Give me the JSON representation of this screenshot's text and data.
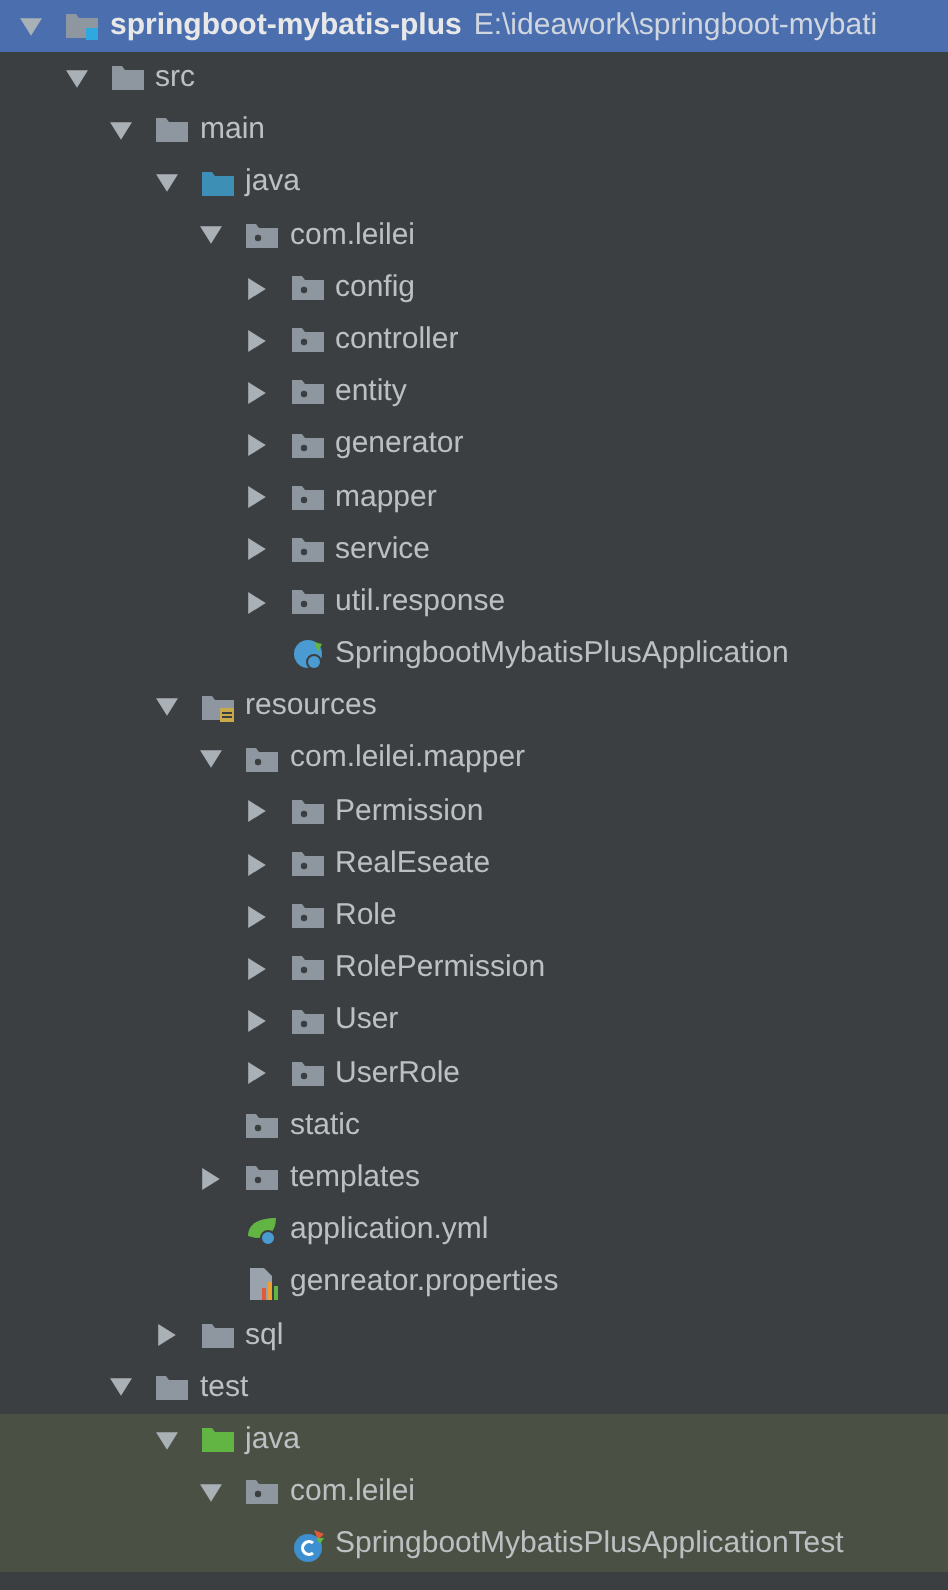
{
  "tree": [
    {
      "name": "springboot-mybatis-plus",
      "path": "E:\\ideawork\\springboot-mybati",
      "kind": "module",
      "expanded": true,
      "selected": true,
      "highlighted": false,
      "children": [
        {
          "name": "src",
          "kind": "folder",
          "expanded": true,
          "selected": false,
          "highlighted": false,
          "children": [
            {
              "name": "main",
              "kind": "folder",
              "expanded": true,
              "selected": false,
              "highlighted": false,
              "children": [
                {
                  "name": "java",
                  "kind": "source_folder",
                  "expanded": true,
                  "selected": false,
                  "highlighted": false,
                  "children": [
                    {
                      "name": "com.leilei",
                      "kind": "package",
                      "expanded": true,
                      "selected": false,
                      "highlighted": false,
                      "children": [
                        {
                          "name": "config",
                          "kind": "package",
                          "expanded": false,
                          "selected": false,
                          "highlighted": false
                        },
                        {
                          "name": "controller",
                          "kind": "package",
                          "expanded": false,
                          "selected": false,
                          "highlighted": false
                        },
                        {
                          "name": "entity",
                          "kind": "package",
                          "expanded": false,
                          "selected": false,
                          "highlighted": false
                        },
                        {
                          "name": "generator",
                          "kind": "package",
                          "expanded": false,
                          "selected": false,
                          "highlighted": false
                        },
                        {
                          "name": "mapper",
                          "kind": "package",
                          "expanded": false,
                          "selected": false,
                          "highlighted": false
                        },
                        {
                          "name": "service",
                          "kind": "package",
                          "expanded": false,
                          "selected": false,
                          "highlighted": false
                        },
                        {
                          "name": "util.response",
                          "kind": "package",
                          "expanded": false,
                          "selected": false,
                          "highlighted": false
                        },
                        {
                          "name": "SpringbootMybatisPlusApplication",
                          "kind": "spring_class",
                          "selected": false,
                          "highlighted": false
                        }
                      ]
                    }
                  ]
                },
                {
                  "name": "resources",
                  "kind": "resources",
                  "expanded": true,
                  "selected": false,
                  "highlighted": false,
                  "children": [
                    {
                      "name": "com.leilei.mapper",
                      "kind": "package",
                      "expanded": true,
                      "selected": false,
                      "highlighted": false,
                      "children": [
                        {
                          "name": "Permission",
                          "kind": "package",
                          "expanded": false,
                          "selected": false,
                          "highlighted": false
                        },
                        {
                          "name": "RealEseate",
                          "kind": "package",
                          "expanded": false,
                          "selected": false,
                          "highlighted": false
                        },
                        {
                          "name": "Role",
                          "kind": "package",
                          "expanded": false,
                          "selected": false,
                          "highlighted": false
                        },
                        {
                          "name": "RolePermission",
                          "kind": "package",
                          "expanded": false,
                          "selected": false,
                          "highlighted": false
                        },
                        {
                          "name": "User",
                          "kind": "package",
                          "expanded": false,
                          "selected": false,
                          "highlighted": false
                        },
                        {
                          "name": "UserRole",
                          "kind": "package",
                          "expanded": false,
                          "selected": false,
                          "highlighted": false
                        }
                      ]
                    },
                    {
                      "name": "static",
                      "kind": "package",
                      "selected": false,
                      "highlighted": false
                    },
                    {
                      "name": "templates",
                      "kind": "package",
                      "expanded": false,
                      "selected": false,
                      "highlighted": false
                    },
                    {
                      "name": "application.yml",
                      "kind": "yml",
                      "selected": false,
                      "highlighted": false
                    },
                    {
                      "name": "genreator.properties",
                      "kind": "properties",
                      "selected": false,
                      "highlighted": false
                    }
                  ]
                },
                {
                  "name": "sql",
                  "kind": "folder",
                  "expanded": false,
                  "selected": false,
                  "highlighted": false
                }
              ]
            },
            {
              "name": "test",
              "kind": "folder",
              "expanded": true,
              "selected": false,
              "highlighted": false,
              "children": [
                {
                  "name": "java",
                  "kind": "test_folder",
                  "expanded": true,
                  "selected": false,
                  "highlighted": true,
                  "children": [
                    {
                      "name": "com.leilei",
                      "kind": "package",
                      "expanded": true,
                      "selected": false,
                      "highlighted": true,
                      "children": [
                        {
                          "name": "SpringbootMybatisPlusApplicationTest",
                          "kind": "test_class",
                          "selected": false,
                          "highlighted": true
                        }
                      ]
                    }
                  ]
                }
              ]
            }
          ]
        }
      ]
    }
  ]
}
